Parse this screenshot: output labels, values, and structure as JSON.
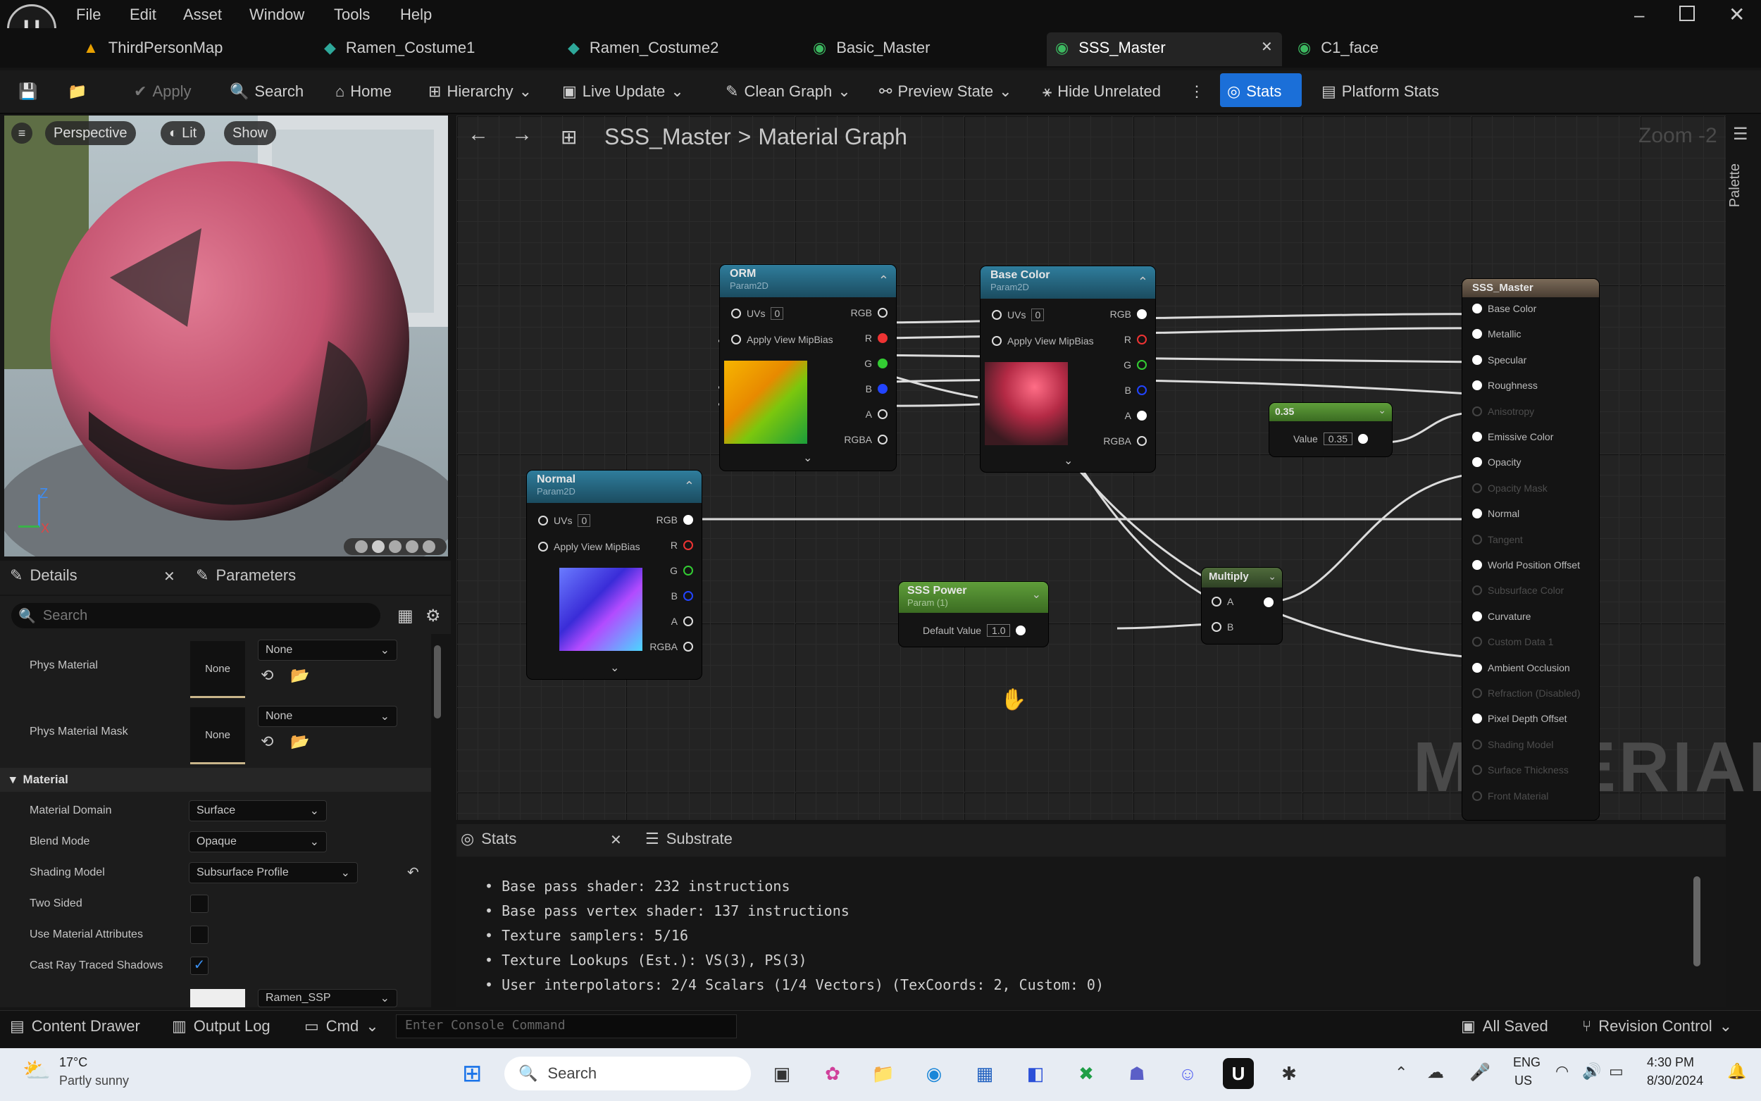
{
  "menu": [
    "File",
    "Edit",
    "Asset",
    "Window",
    "Tools",
    "Help"
  ],
  "tabs": [
    {
      "label": "ThirdPersonMap"
    },
    {
      "label": "Ramen_Costume1"
    },
    {
      "label": "Ramen_Costume2"
    },
    {
      "label": "Basic_Master"
    },
    {
      "label": "SSS_Master"
    },
    {
      "label": "C1_face"
    }
  ],
  "toolbar": {
    "apply": "Apply",
    "search": "Search",
    "home": "Home",
    "hierarchy": "Hierarchy",
    "live_update": "Live Update",
    "clean_graph": "Clean Graph",
    "preview_state": "Preview State",
    "hide_unrelated": "Hide Unrelated",
    "stats": "Stats",
    "platform_stats": "Platform Stats"
  },
  "viewport": {
    "perspective": "Perspective",
    "lit": "Lit",
    "show": "Show"
  },
  "details": {
    "tab_details": "Details",
    "tab_parameters": "Parameters",
    "search_placeholder": "Search",
    "phys_material": "Phys Material",
    "phys_material_mask": "Phys Material Mask",
    "none": "None",
    "section": "Material",
    "rows": [
      {
        "label": "Material Domain",
        "value": "Surface"
      },
      {
        "label": "Blend Mode",
        "value": "Opaque"
      },
      {
        "label": "Shading Model",
        "value": "Subsurface Profile"
      },
      {
        "label": "Two Sided"
      },
      {
        "label": "Use Material Attributes"
      },
      {
        "label": "Cast Ray Traced Shadows"
      }
    ],
    "profile": "Ramen_SSP"
  },
  "graph": {
    "breadcrumb_root": "SSS_Master",
    "breadcrumb_sep": ">",
    "breadcrumb_page": "Material Graph",
    "zoom": "Zoom -2",
    "palette": "Palette",
    "watermark": "MATERIAL",
    "orm": {
      "title": "ORM",
      "sub": "Param2D"
    },
    "basecolor": {
      "title": "Base Color",
      "sub": "Param2D"
    },
    "normal": {
      "title": "Normal",
      "sub": "Param2D"
    },
    "tex_pins": {
      "uvs": "UVs",
      "uvs_val": "0",
      "mip": "Apply View MipBias",
      "rgb": "RGB",
      "r": "R",
      "g": "G",
      "b": "B",
      "a": "A",
      "rgba": "RGBA"
    },
    "const": {
      "title": "0.35",
      "label": "Value",
      "value": "0.35"
    },
    "sss": {
      "title": "SSS Power",
      "sub": "Param (1)",
      "label": "Default Value",
      "value": "1.0"
    },
    "multiply": {
      "title": "Multiply",
      "a": "A",
      "b": "B"
    },
    "master": {
      "title": "SSS_Master",
      "pins": [
        "Base Color",
        "Metallic",
        "Specular",
        "Roughness",
        "Anisotropy",
        "Emissive Color",
        "Opacity",
        "Opacity Mask",
        "Normal",
        "Tangent",
        "World Position Offset",
        "Subsurface Color",
        "Curvature",
        "Custom Data 1",
        "Ambient Occlusion",
        "Refraction (Disabled)",
        "Pixel Depth Offset",
        "Shading Model",
        "Surface Thickness",
        "Front Material"
      ]
    }
  },
  "stats": {
    "tab_stats": "Stats",
    "tab_substrate": "Substrate",
    "lines": [
      "Base pass shader: 232 instructions",
      "Base pass vertex shader: 137 instructions",
      "Texture samplers: 5/16",
      "Texture Lookups (Est.): VS(3), PS(3)",
      "User interpolators: 2/4 Scalars (1/4 Vectors) (TexCoords: 2, Custom: 0)"
    ]
  },
  "bottom": {
    "content_drawer": "Content Drawer",
    "output_log": "Output Log",
    "cmd": "Cmd",
    "console_placeholder": "Enter Console Command",
    "all_saved": "All Saved",
    "revision_control": "Revision Control"
  },
  "taskbar": {
    "temp": "17°C",
    "weather": "Partly sunny",
    "search": "Search",
    "lang1": "ENG",
    "lang2": "US",
    "time": "4:30 PM",
    "date": "8/30/2024"
  }
}
